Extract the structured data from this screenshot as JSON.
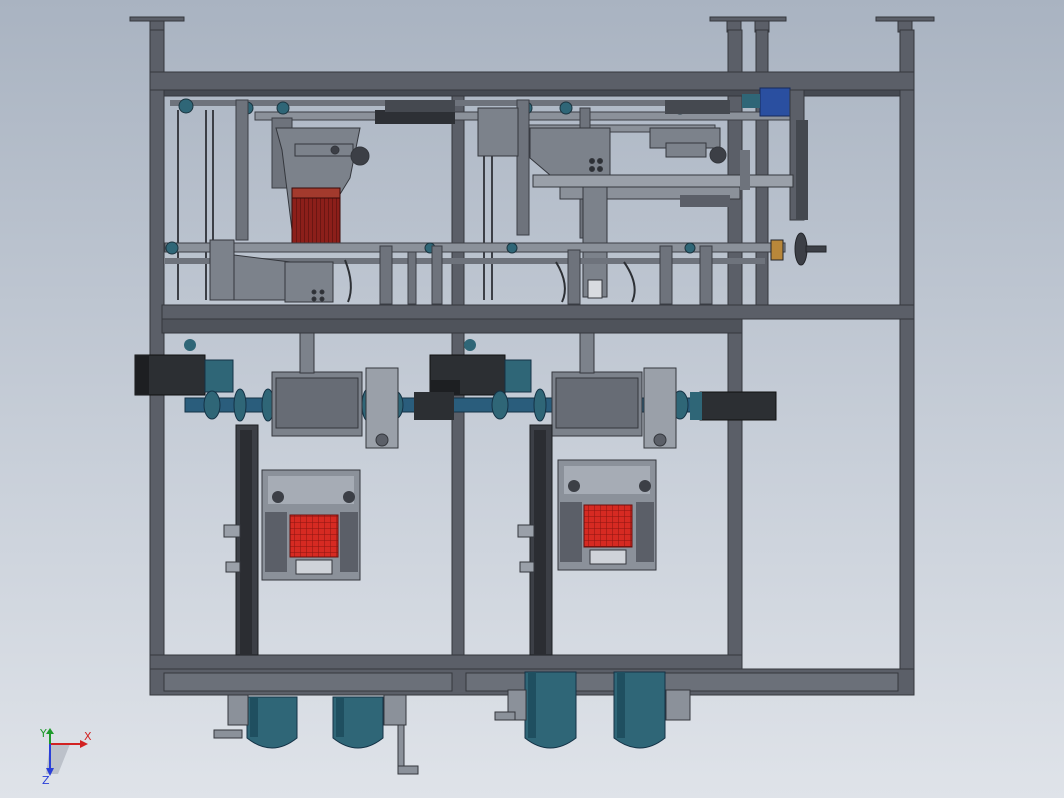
{
  "viewport": {
    "background_top": "#a9b3c1",
    "background_bottom": "#dfe3e9"
  },
  "palette": {
    "frame": "#5b5f68",
    "frame_dark": "#3c3f46",
    "steel_light": "#9aa0a9",
    "motor_dark": "#2c2f33",
    "motor_teal": "#2f6677",
    "coupling_blue": "#2a5d7c",
    "heater_red": "#c8221c",
    "brake_brown": "#7a1f1c",
    "bronze_knob": "#b8873a"
  },
  "coordinate_triad": {
    "x_label": "X",
    "y_label": "Y",
    "z_label": "Z",
    "x_color": "#d22222",
    "y_color": "#1d9a2b",
    "z_color": "#2a3fd8"
  }
}
